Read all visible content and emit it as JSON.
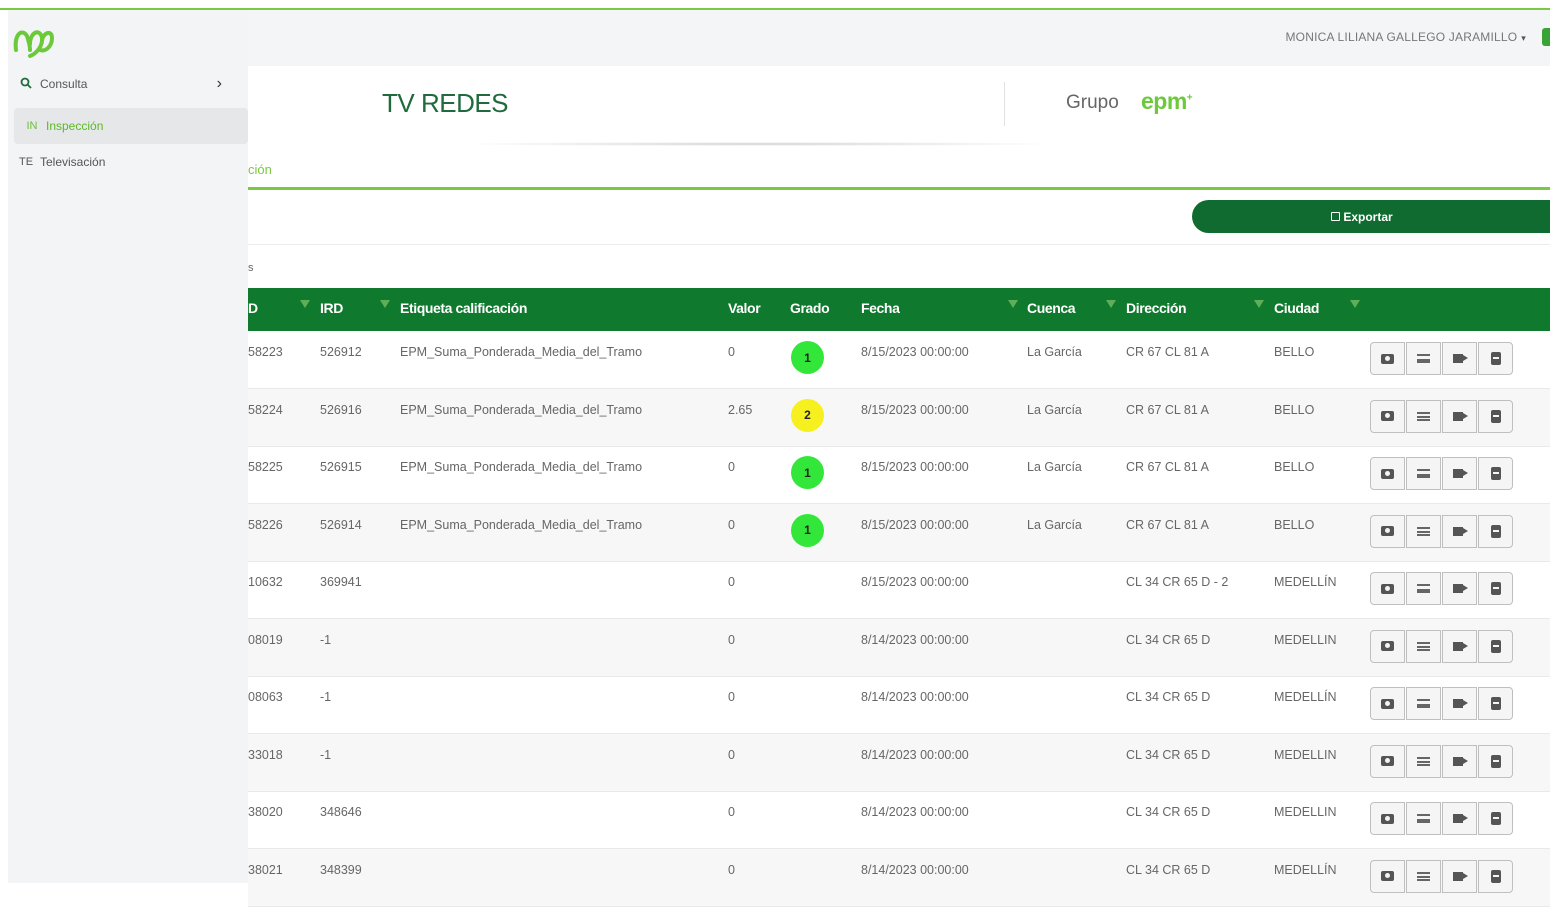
{
  "colors": {
    "accent": "#7ac943",
    "header_green": "#0f7a2e",
    "button_green": "#0f6b2f",
    "grade_green": "#32e63a",
    "grade_yellow": "#f6f01e"
  },
  "sidebar": {
    "logo_icon": "mm-logo-icon",
    "items": [
      {
        "code": "search-icon",
        "label": "Consulta",
        "chevron": "›"
      },
      {
        "code": "IN",
        "label": "Inspección"
      },
      {
        "code": "TE",
        "label": "Televisación"
      }
    ]
  },
  "header": {
    "user_name": "MONICA LILIANA GALLEGO JARAMILLO",
    "caret": "▾"
  },
  "banner": {
    "title": "TV REDES",
    "group_text": "Grupo",
    "brand": "epm",
    "breadcrumb_fragment": "ción"
  },
  "toolbar": {
    "export_label": "Exportar"
  },
  "count_fragment": "s",
  "table": {
    "columns": [
      "D",
      "IRD",
      "Etiqueta calificación",
      "Valor",
      "Grado",
      "Fecha",
      "Cuenca",
      "Dirección",
      "Ciudad"
    ],
    "rows": [
      {
        "id": "58223",
        "ird": "526912",
        "etiqueta": "EPM_Suma_Ponderada_Media_del_Tramo",
        "valor": "0",
        "grado": "1",
        "grado_color": "green",
        "fecha": "8/15/2023 00:00:00",
        "cuenca": "La García",
        "direccion": "CR 67 CL 81 A",
        "ciudad": "BELLO"
      },
      {
        "id": "58224",
        "ird": "526916",
        "etiqueta": "EPM_Suma_Ponderada_Media_del_Tramo",
        "valor": "2.65",
        "grado": "2",
        "grado_color": "yellow",
        "fecha": "8/15/2023 00:00:00",
        "cuenca": "La García",
        "direccion": "CR 67 CL 81 A",
        "ciudad": "BELLO"
      },
      {
        "id": "58225",
        "ird": "526915",
        "etiqueta": "EPM_Suma_Ponderada_Media_del_Tramo",
        "valor": "0",
        "grado": "1",
        "grado_color": "green",
        "fecha": "8/15/2023 00:00:00",
        "cuenca": "La García",
        "direccion": "CR 67 CL 81 A",
        "ciudad": "BELLO"
      },
      {
        "id": "58226",
        "ird": "526914",
        "etiqueta": "EPM_Suma_Ponderada_Media_del_Tramo",
        "valor": "0",
        "grado": "1",
        "grado_color": "green",
        "fecha": "8/15/2023 00:00:00",
        "cuenca": "La García",
        "direccion": "CR 67 CL 81 A",
        "ciudad": "BELLO"
      },
      {
        "id": "10632",
        "ird": "369941",
        "etiqueta": "",
        "valor": "0",
        "grado": "",
        "grado_color": "",
        "fecha": "8/15/2023 00:00:00",
        "cuenca": "",
        "direccion": "CL 34 CR 65 D - 2",
        "ciudad": "MEDELLÍN"
      },
      {
        "id": "08019",
        "ird": "-1",
        "etiqueta": "",
        "valor": "0",
        "grado": "",
        "grado_color": "",
        "fecha": "8/14/2023 00:00:00",
        "cuenca": "",
        "direccion": "CL 34 CR 65 D",
        "ciudad": "MEDELLIN"
      },
      {
        "id": "08063",
        "ird": "-1",
        "etiqueta": "",
        "valor": "0",
        "grado": "",
        "grado_color": "",
        "fecha": "8/14/2023 00:00:00",
        "cuenca": "",
        "direccion": "CL 34 CR 65 D",
        "ciudad": "MEDELLÍN"
      },
      {
        "id": "33018",
        "ird": "-1",
        "etiqueta": "",
        "valor": "0",
        "grado": "",
        "grado_color": "",
        "fecha": "8/14/2023 00:00:00",
        "cuenca": "",
        "direccion": "CL 34 CR 65 D",
        "ciudad": "MEDELLIN"
      },
      {
        "id": "38020",
        "ird": "348646",
        "etiqueta": "",
        "valor": "0",
        "grado": "",
        "grado_color": "",
        "fecha": "8/14/2023 00:00:00",
        "cuenca": "",
        "direccion": "CL 34 CR 65 D",
        "ciudad": "MEDELLIN"
      },
      {
        "id": "38021",
        "ird": "348399",
        "etiqueta": "",
        "valor": "0",
        "grado": "",
        "grado_color": "",
        "fecha": "8/14/2023 00:00:00",
        "cuenca": "",
        "direccion": "CL 34 CR 65 D",
        "ciudad": "MEDELLÍN"
      }
    ],
    "row_actions": [
      "camera-icon",
      "list-icon",
      "video-icon",
      "document-icon"
    ]
  }
}
